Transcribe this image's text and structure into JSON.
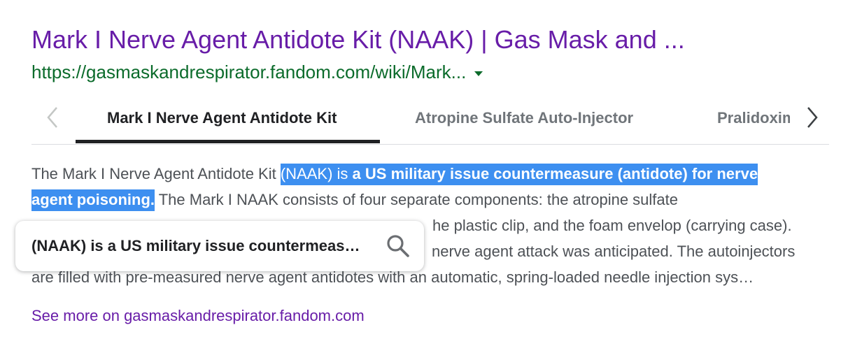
{
  "result": {
    "title": "Mark I Nerve Agent Antidote Kit (NAAK) | Gas Mask and ...",
    "url": "https://gasmaskandrespirator.fandom.com/wiki/Mark...",
    "tabs": [
      {
        "label": "Mark I Nerve Agent Antidote Kit",
        "active": true
      },
      {
        "label": "Atropine Sulfate Auto-Injector",
        "active": false
      },
      {
        "label": "Pralidoxime Chloride Auto-Injector",
        "active": false
      }
    ],
    "snippet": {
      "line1_pre": "The Mark I Nerve Agent Antidote Kit ",
      "line1_hl_plain": "(NAAK) is ",
      "line1_hl_bold": "a US military issue countermeasure (antidote) for nerve",
      "line2_hl_bold": "agent poisoning.",
      "line2_post": " The Mark I NAAK consists of four separate components: the atropine sulfate",
      "line3_visible": "he plastic clip, and the foam envelop (carrying case).",
      "line4_visible": "nerve agent attack was anticipated. The autoinjectors",
      "line5": "are filled with pre-measured nerve agent antidotes with an automatic, spring-loaded needle injection sys…"
    },
    "see_more": "See more on gasmaskandrespirator.fandom.com"
  },
  "popup": {
    "text": "(NAAK) is a US military issue countermeasure (antidote) for nerve agent poisoning.",
    "icon": "search-icon"
  },
  "colors": {
    "title": "#681da8",
    "url": "#0b6b2b",
    "highlight": "#3d8ff0",
    "snippet": "#4d5156"
  }
}
